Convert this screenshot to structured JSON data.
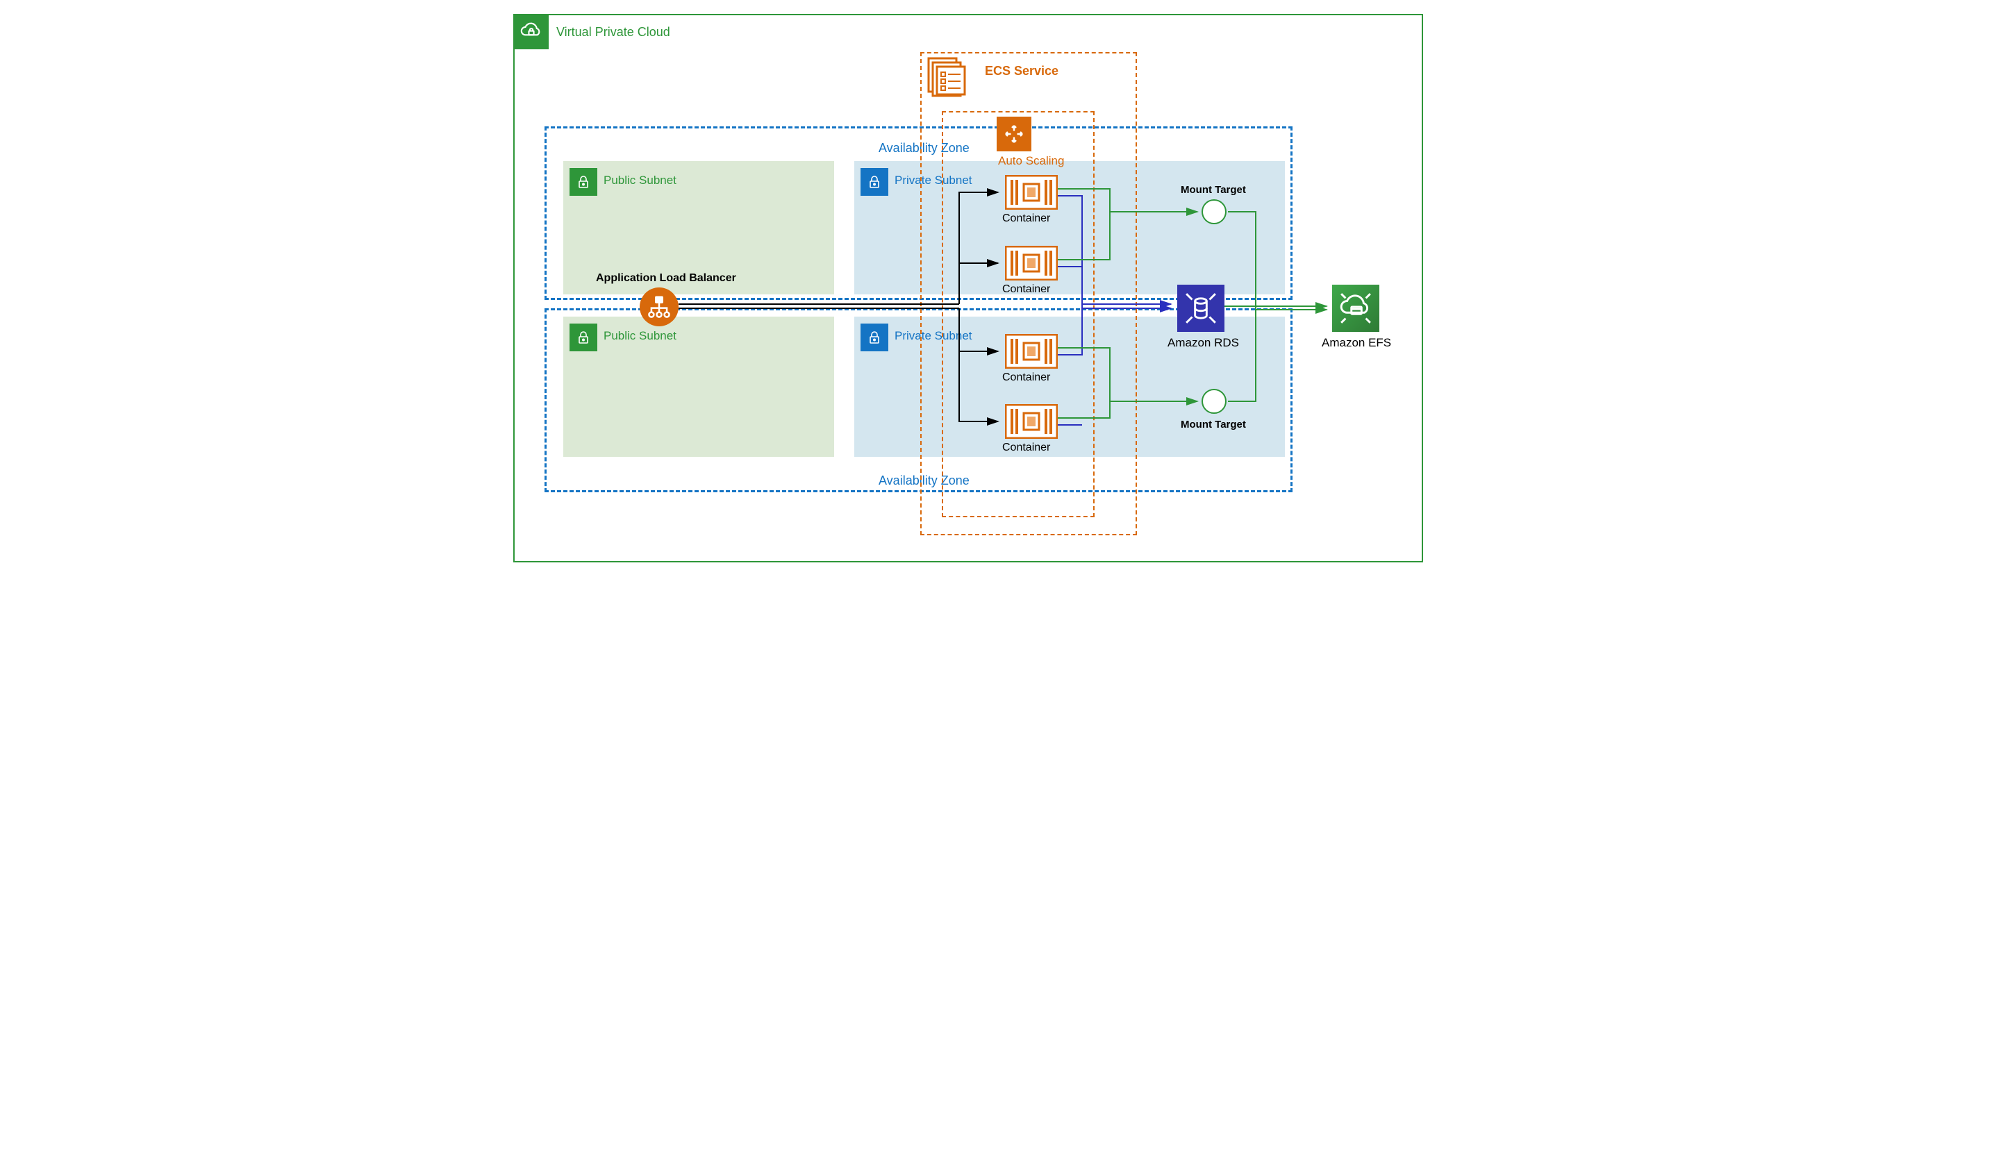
{
  "vpc": {
    "label": "Virtual Private Cloud"
  },
  "az": {
    "label1": "Availability Zone",
    "label2": "Availability Zone"
  },
  "public_subnets": {
    "s1": "Public Subnet",
    "s2": "Public Subnet"
  },
  "private_subnets": {
    "s1": "Private Subnet",
    "s2": "Private Subnet"
  },
  "ecs": {
    "label": "ECS Service"
  },
  "asg": {
    "label": "Auto Scaling"
  },
  "containers": {
    "c1": "Container",
    "c2": "Container",
    "c3": "Container",
    "c4": "Container"
  },
  "mount_targets": {
    "m1": "Mount Target",
    "m2": "Mount Target"
  },
  "rds": {
    "label": "Amazon RDS"
  },
  "efs": {
    "label": "Amazon EFS"
  },
  "alb": {
    "label": "Application Load Balancer"
  },
  "colors": {
    "vpc_green": "#2e9639",
    "az_blue": "#1474c4",
    "ecs_orange": "#d8690b",
    "rds_purple": "#3334ac"
  }
}
